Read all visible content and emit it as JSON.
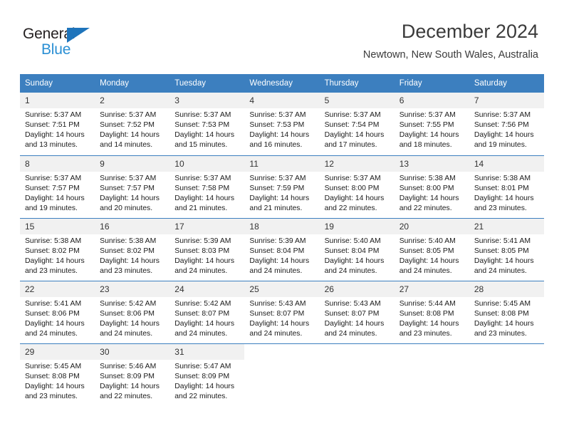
{
  "logo": {
    "word_dark": "General",
    "word_blue": "Blue",
    "triangle": "blue-triangle-icon"
  },
  "header": {
    "title": "December 2024",
    "subtitle": "Newtown, New South Wales, Australia"
  },
  "colors": {
    "header_blue": "#3c7fbf",
    "logo_blue": "#2a8fd4",
    "daynum_bg": "#f1f1f1",
    "text": "#1a1a1a"
  },
  "calendar": {
    "day_headers": [
      "Sunday",
      "Monday",
      "Tuesday",
      "Wednesday",
      "Thursday",
      "Friday",
      "Saturday"
    ],
    "weeks": [
      [
        {
          "day": "1",
          "sunrise": "Sunrise: 5:37 AM",
          "sunset": "Sunset: 7:51 PM",
          "daylight1": "Daylight: 14 hours",
          "daylight2": "and 13 minutes."
        },
        {
          "day": "2",
          "sunrise": "Sunrise: 5:37 AM",
          "sunset": "Sunset: 7:52 PM",
          "daylight1": "Daylight: 14 hours",
          "daylight2": "and 14 minutes."
        },
        {
          "day": "3",
          "sunrise": "Sunrise: 5:37 AM",
          "sunset": "Sunset: 7:53 PM",
          "daylight1": "Daylight: 14 hours",
          "daylight2": "and 15 minutes."
        },
        {
          "day": "4",
          "sunrise": "Sunrise: 5:37 AM",
          "sunset": "Sunset: 7:53 PM",
          "daylight1": "Daylight: 14 hours",
          "daylight2": "and 16 minutes."
        },
        {
          "day": "5",
          "sunrise": "Sunrise: 5:37 AM",
          "sunset": "Sunset: 7:54 PM",
          "daylight1": "Daylight: 14 hours",
          "daylight2": "and 17 minutes."
        },
        {
          "day": "6",
          "sunrise": "Sunrise: 5:37 AM",
          "sunset": "Sunset: 7:55 PM",
          "daylight1": "Daylight: 14 hours",
          "daylight2": "and 18 minutes."
        },
        {
          "day": "7",
          "sunrise": "Sunrise: 5:37 AM",
          "sunset": "Sunset: 7:56 PM",
          "daylight1": "Daylight: 14 hours",
          "daylight2": "and 19 minutes."
        }
      ],
      [
        {
          "day": "8",
          "sunrise": "Sunrise: 5:37 AM",
          "sunset": "Sunset: 7:57 PM",
          "daylight1": "Daylight: 14 hours",
          "daylight2": "and 19 minutes."
        },
        {
          "day": "9",
          "sunrise": "Sunrise: 5:37 AM",
          "sunset": "Sunset: 7:57 PM",
          "daylight1": "Daylight: 14 hours",
          "daylight2": "and 20 minutes."
        },
        {
          "day": "10",
          "sunrise": "Sunrise: 5:37 AM",
          "sunset": "Sunset: 7:58 PM",
          "daylight1": "Daylight: 14 hours",
          "daylight2": "and 21 minutes."
        },
        {
          "day": "11",
          "sunrise": "Sunrise: 5:37 AM",
          "sunset": "Sunset: 7:59 PM",
          "daylight1": "Daylight: 14 hours",
          "daylight2": "and 21 minutes."
        },
        {
          "day": "12",
          "sunrise": "Sunrise: 5:37 AM",
          "sunset": "Sunset: 8:00 PM",
          "daylight1": "Daylight: 14 hours",
          "daylight2": "and 22 minutes."
        },
        {
          "day": "13",
          "sunrise": "Sunrise: 5:38 AM",
          "sunset": "Sunset: 8:00 PM",
          "daylight1": "Daylight: 14 hours",
          "daylight2": "and 22 minutes."
        },
        {
          "day": "14",
          "sunrise": "Sunrise: 5:38 AM",
          "sunset": "Sunset: 8:01 PM",
          "daylight1": "Daylight: 14 hours",
          "daylight2": "and 23 minutes."
        }
      ],
      [
        {
          "day": "15",
          "sunrise": "Sunrise: 5:38 AM",
          "sunset": "Sunset: 8:02 PM",
          "daylight1": "Daylight: 14 hours",
          "daylight2": "and 23 minutes."
        },
        {
          "day": "16",
          "sunrise": "Sunrise: 5:38 AM",
          "sunset": "Sunset: 8:02 PM",
          "daylight1": "Daylight: 14 hours",
          "daylight2": "and 23 minutes."
        },
        {
          "day": "17",
          "sunrise": "Sunrise: 5:39 AM",
          "sunset": "Sunset: 8:03 PM",
          "daylight1": "Daylight: 14 hours",
          "daylight2": "and 24 minutes."
        },
        {
          "day": "18",
          "sunrise": "Sunrise: 5:39 AM",
          "sunset": "Sunset: 8:04 PM",
          "daylight1": "Daylight: 14 hours",
          "daylight2": "and 24 minutes."
        },
        {
          "day": "19",
          "sunrise": "Sunrise: 5:40 AM",
          "sunset": "Sunset: 8:04 PM",
          "daylight1": "Daylight: 14 hours",
          "daylight2": "and 24 minutes."
        },
        {
          "day": "20",
          "sunrise": "Sunrise: 5:40 AM",
          "sunset": "Sunset: 8:05 PM",
          "daylight1": "Daylight: 14 hours",
          "daylight2": "and 24 minutes."
        },
        {
          "day": "21",
          "sunrise": "Sunrise: 5:41 AM",
          "sunset": "Sunset: 8:05 PM",
          "daylight1": "Daylight: 14 hours",
          "daylight2": "and 24 minutes."
        }
      ],
      [
        {
          "day": "22",
          "sunrise": "Sunrise: 5:41 AM",
          "sunset": "Sunset: 8:06 PM",
          "daylight1": "Daylight: 14 hours",
          "daylight2": "and 24 minutes."
        },
        {
          "day": "23",
          "sunrise": "Sunrise: 5:42 AM",
          "sunset": "Sunset: 8:06 PM",
          "daylight1": "Daylight: 14 hours",
          "daylight2": "and 24 minutes."
        },
        {
          "day": "24",
          "sunrise": "Sunrise: 5:42 AM",
          "sunset": "Sunset: 8:07 PM",
          "daylight1": "Daylight: 14 hours",
          "daylight2": "and 24 minutes."
        },
        {
          "day": "25",
          "sunrise": "Sunrise: 5:43 AM",
          "sunset": "Sunset: 8:07 PM",
          "daylight1": "Daylight: 14 hours",
          "daylight2": "and 24 minutes."
        },
        {
          "day": "26",
          "sunrise": "Sunrise: 5:43 AM",
          "sunset": "Sunset: 8:07 PM",
          "daylight1": "Daylight: 14 hours",
          "daylight2": "and 24 minutes."
        },
        {
          "day": "27",
          "sunrise": "Sunrise: 5:44 AM",
          "sunset": "Sunset: 8:08 PM",
          "daylight1": "Daylight: 14 hours",
          "daylight2": "and 23 minutes."
        },
        {
          "day": "28",
          "sunrise": "Sunrise: 5:45 AM",
          "sunset": "Sunset: 8:08 PM",
          "daylight1": "Daylight: 14 hours",
          "daylight2": "and 23 minutes."
        }
      ],
      [
        {
          "day": "29",
          "sunrise": "Sunrise: 5:45 AM",
          "sunset": "Sunset: 8:08 PM",
          "daylight1": "Daylight: 14 hours",
          "daylight2": "and 23 minutes."
        },
        {
          "day": "30",
          "sunrise": "Sunrise: 5:46 AM",
          "sunset": "Sunset: 8:09 PM",
          "daylight1": "Daylight: 14 hours",
          "daylight2": "and 22 minutes."
        },
        {
          "day": "31",
          "sunrise": "Sunrise: 5:47 AM",
          "sunset": "Sunset: 8:09 PM",
          "daylight1": "Daylight: 14 hours",
          "daylight2": "and 22 minutes."
        },
        {
          "day": "",
          "sunrise": "",
          "sunset": "",
          "daylight1": "",
          "daylight2": ""
        },
        {
          "day": "",
          "sunrise": "",
          "sunset": "",
          "daylight1": "",
          "daylight2": ""
        },
        {
          "day": "",
          "sunrise": "",
          "sunset": "",
          "daylight1": "",
          "daylight2": ""
        },
        {
          "day": "",
          "sunrise": "",
          "sunset": "",
          "daylight1": "",
          "daylight2": ""
        }
      ]
    ]
  }
}
